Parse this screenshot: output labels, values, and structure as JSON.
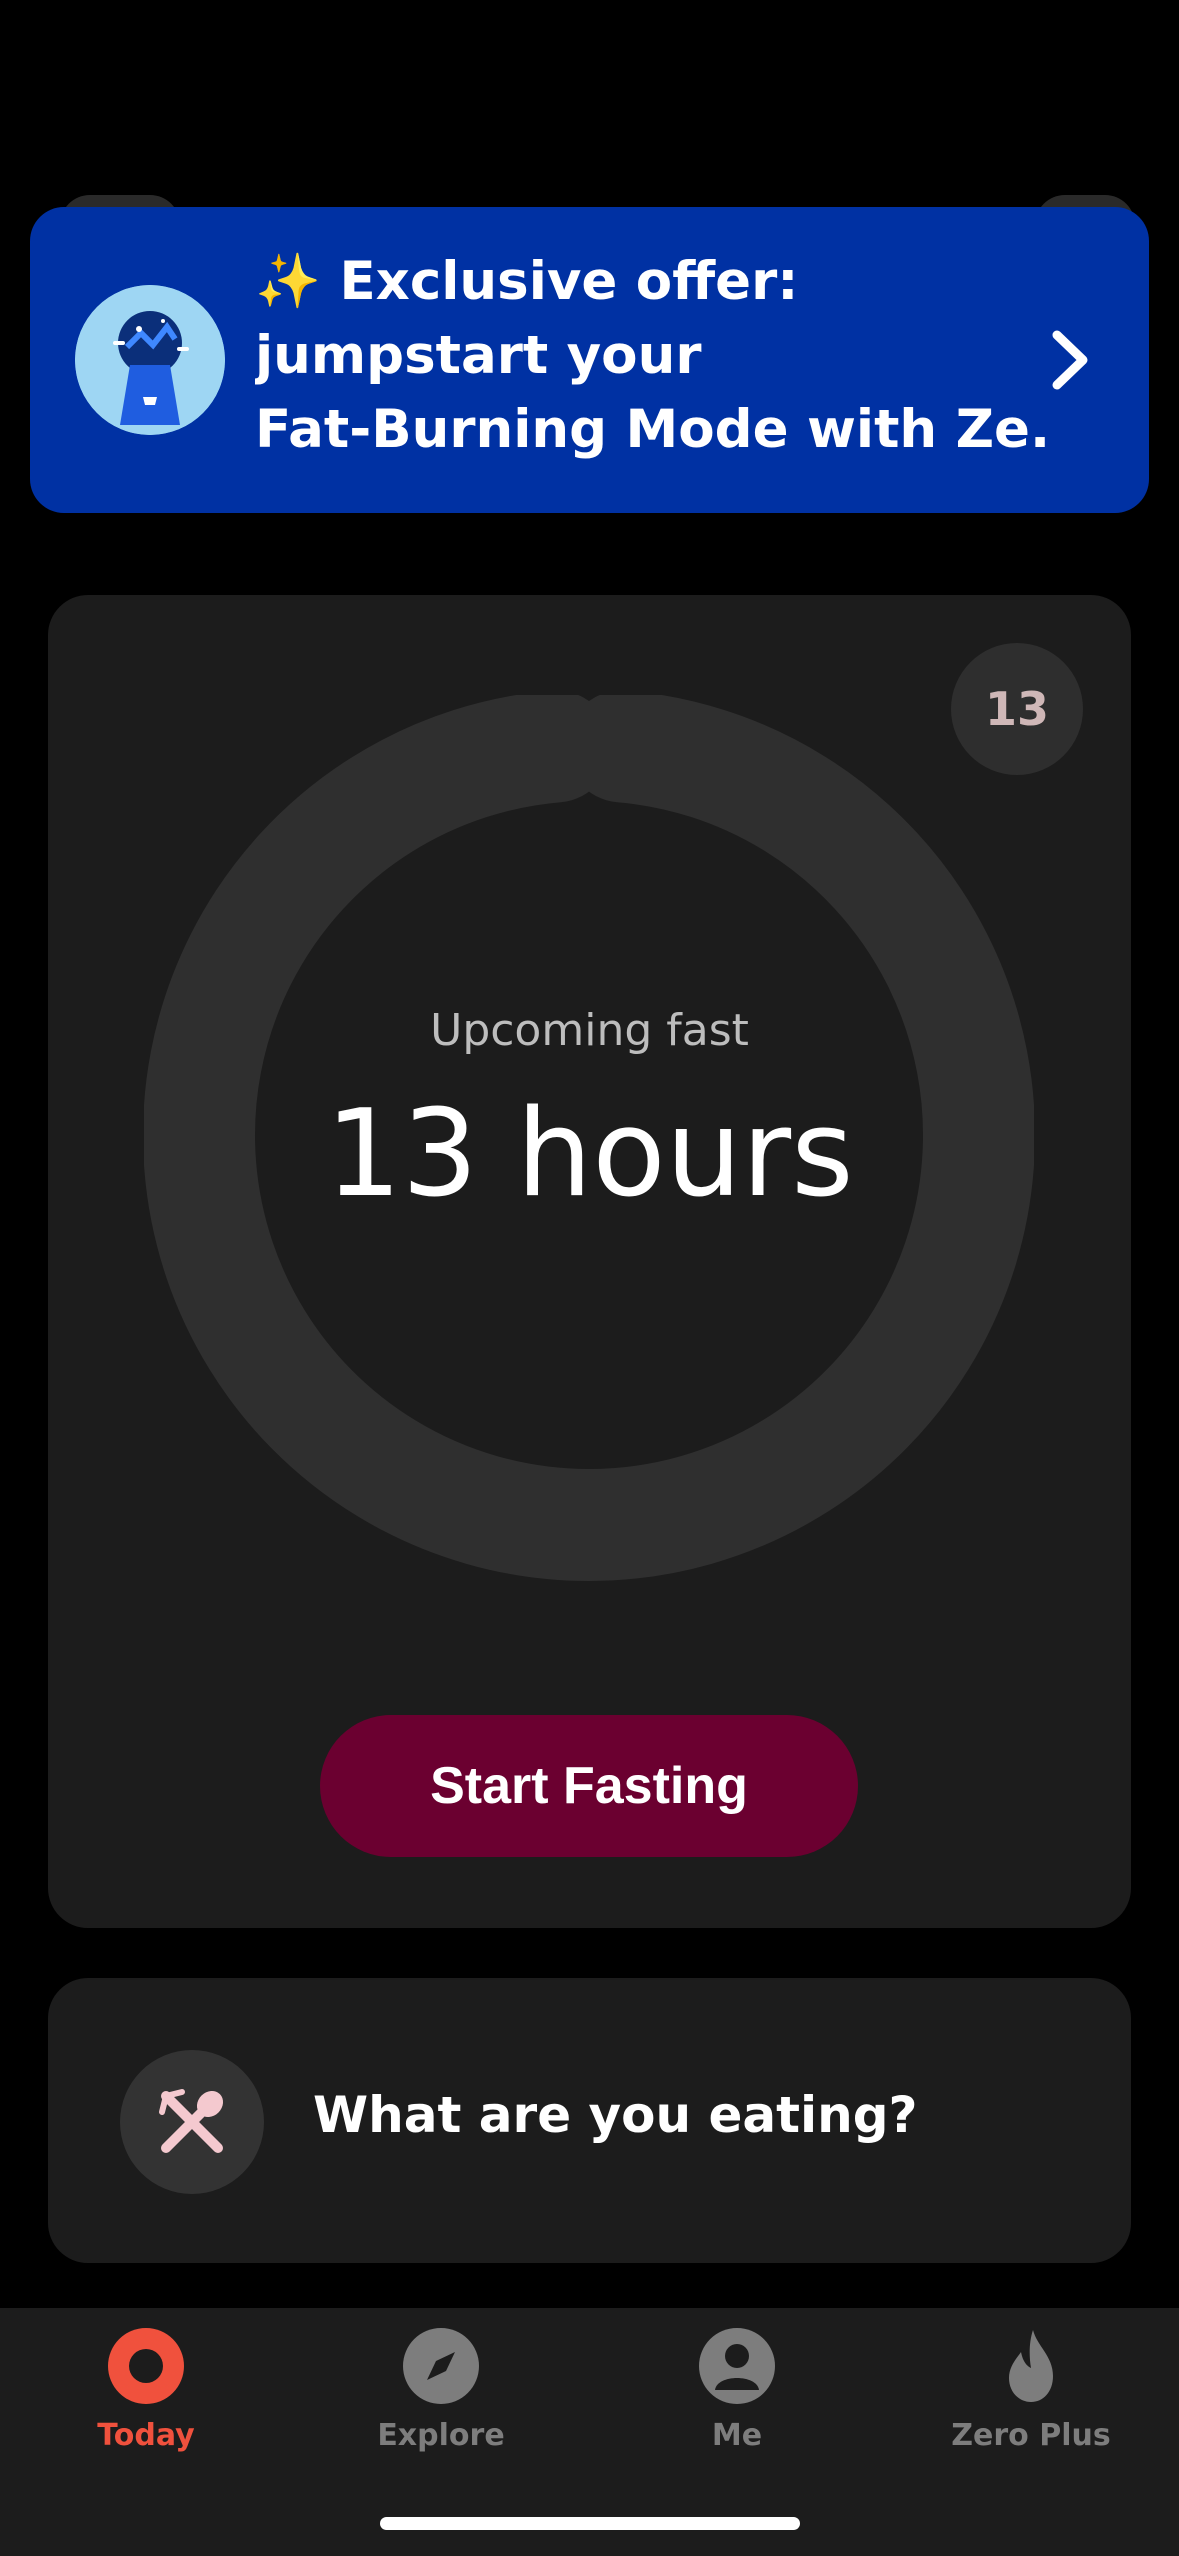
{
  "offer": {
    "line1": "✨ Exclusive offer:",
    "line2": "jumpstart your",
    "line3": "Fat-Burning Mode with Ze...",
    "avatar_icon": "keyhole-illustration-icon",
    "chevron_icon": "chevron-right-icon",
    "background_color": "#0031a3"
  },
  "fast_card": {
    "day_badge": "13",
    "status_label": "Upcoming fast",
    "duration": "13 hours",
    "start_button": "Start Fasting",
    "accent_color": "#6b0030"
  },
  "eating_card": {
    "prompt": "What are you eating?",
    "icon": "fork-spoon-icon"
  },
  "tabbar": {
    "active_color": "#f0513d",
    "tabs": [
      {
        "label": "Today",
        "icon": "ring-icon",
        "active": true
      },
      {
        "label": "Explore",
        "icon": "compass-icon",
        "active": false
      },
      {
        "label": "Me",
        "icon": "person-icon",
        "active": false
      },
      {
        "label": "Zero Plus",
        "icon": "flame-icon",
        "active": false
      }
    ]
  }
}
